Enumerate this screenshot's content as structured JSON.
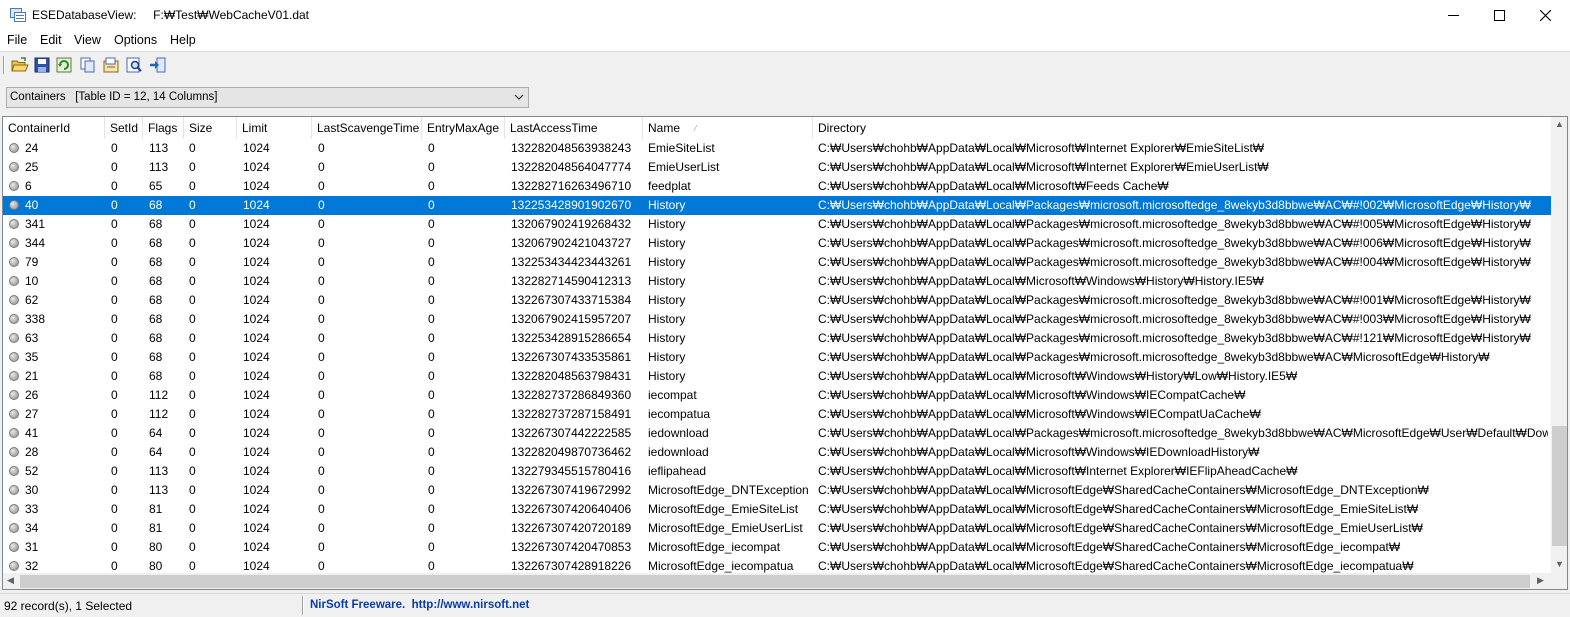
{
  "window": {
    "title": "ESEDatabaseView:     F:₩Test₩WebCacheV01.dat"
  },
  "menu": [
    {
      "label": "File"
    },
    {
      "label": "Edit"
    },
    {
      "label": "View"
    },
    {
      "label": "Options"
    },
    {
      "label": "Help"
    }
  ],
  "toolbar": {
    "icons": [
      "open-folder-icon",
      "save-icon",
      "refresh-icon",
      "copy-icon",
      "properties-icon",
      "find-icon",
      "exit-icon"
    ]
  },
  "table_select": {
    "value": "Containers   [Table ID = 12, 14 Columns]"
  },
  "table": {
    "columns": [
      "ContainerId",
      "SetId",
      "Flags",
      "Size",
      "Limit",
      "LastScavengeTime",
      "EntryMaxAge",
      "LastAccessTime",
      "Name",
      "Directory"
    ],
    "sort_column": "Name",
    "rows": [
      [
        "24",
        "0",
        "113",
        "0",
        "1024",
        "0",
        "0",
        "132282048563938243",
        "EmieSiteList",
        "C:₩Users₩chohb₩AppData₩Local₩Microsoft₩Internet Explorer₩EmieSiteList₩"
      ],
      [
        "25",
        "0",
        "113",
        "0",
        "1024",
        "0",
        "0",
        "132282048564047774",
        "EmieUserList",
        "C:₩Users₩chohb₩AppData₩Local₩Microsoft₩Internet Explorer₩EmieUserList₩"
      ],
      [
        "6",
        "0",
        "65",
        "0",
        "1024",
        "0",
        "0",
        "132282716263496710",
        "feedplat",
        "C:₩Users₩chohb₩AppData₩Local₩Microsoft₩Feeds Cache₩"
      ],
      [
        "40",
        "0",
        "68",
        "0",
        "1024",
        "0",
        "0",
        "132253428901902670",
        "History",
        "C:₩Users₩chohb₩AppData₩Local₩Packages₩microsoft.microsoftedge_8wekyb3d8bbwe₩AC₩#!002₩MicrosoftEdge₩History₩"
      ],
      [
        "341",
        "0",
        "68",
        "0",
        "1024",
        "0",
        "0",
        "132067902419268432",
        "History",
        "C:₩Users₩chohb₩AppData₩Local₩Packages₩microsoft.microsoftedge_8wekyb3d8bbwe₩AC₩#!005₩MicrosoftEdge₩History₩"
      ],
      [
        "344",
        "0",
        "68",
        "0",
        "1024",
        "0",
        "0",
        "132067902421043727",
        "History",
        "C:₩Users₩chohb₩AppData₩Local₩Packages₩microsoft.microsoftedge_8wekyb3d8bbwe₩AC₩#!006₩MicrosoftEdge₩History₩"
      ],
      [
        "79",
        "0",
        "68",
        "0",
        "1024",
        "0",
        "0",
        "132253434423443261",
        "History",
        "C:₩Users₩chohb₩AppData₩Local₩Packages₩microsoft.microsoftedge_8wekyb3d8bbwe₩AC₩#!004₩MicrosoftEdge₩History₩"
      ],
      [
        "10",
        "0",
        "68",
        "0",
        "1024",
        "0",
        "0",
        "132282714590412313",
        "History",
        "C:₩Users₩chohb₩AppData₩Local₩Microsoft₩Windows₩History₩History.IE5₩"
      ],
      [
        "62",
        "0",
        "68",
        "0",
        "1024",
        "0",
        "0",
        "132267307433715384",
        "History",
        "C:₩Users₩chohb₩AppData₩Local₩Packages₩microsoft.microsoftedge_8wekyb3d8bbwe₩AC₩#!001₩MicrosoftEdge₩History₩"
      ],
      [
        "338",
        "0",
        "68",
        "0",
        "1024",
        "0",
        "0",
        "132067902415957207",
        "History",
        "C:₩Users₩chohb₩AppData₩Local₩Packages₩microsoft.microsoftedge_8wekyb3d8bbwe₩AC₩#!003₩MicrosoftEdge₩History₩"
      ],
      [
        "63",
        "0",
        "68",
        "0",
        "1024",
        "0",
        "0",
        "132253428915286654",
        "History",
        "C:₩Users₩chohb₩AppData₩Local₩Packages₩microsoft.microsoftedge_8wekyb3d8bbwe₩AC₩#!121₩MicrosoftEdge₩History₩"
      ],
      [
        "35",
        "0",
        "68",
        "0",
        "1024",
        "0",
        "0",
        "132267307433535861",
        "History",
        "C:₩Users₩chohb₩AppData₩Local₩Packages₩microsoft.microsoftedge_8wekyb3d8bbwe₩AC₩MicrosoftEdge₩History₩"
      ],
      [
        "21",
        "0",
        "68",
        "0",
        "1024",
        "0",
        "0",
        "132282048563798431",
        "History",
        "C:₩Users₩chohb₩AppData₩Local₩Microsoft₩Windows₩History₩Low₩History.IE5₩"
      ],
      [
        "26",
        "0",
        "112",
        "0",
        "1024",
        "0",
        "0",
        "132282737286849360",
        "iecompat",
        "C:₩Users₩chohb₩AppData₩Local₩Microsoft₩Windows₩IECompatCache₩"
      ],
      [
        "27",
        "0",
        "112",
        "0",
        "1024",
        "0",
        "0",
        "132282737287158491",
        "iecompatua",
        "C:₩Users₩chohb₩AppData₩Local₩Microsoft₩Windows₩IECompatUaCache₩"
      ],
      [
        "41",
        "0",
        "64",
        "0",
        "1024",
        "0",
        "0",
        "132267307442222585",
        "iedownload",
        "C:₩Users₩chohb₩AppData₩Local₩Packages₩microsoft.microsoftedge_8wekyb3d8bbwe₩AC₩MicrosoftEdge₩User₩Default₩Download"
      ],
      [
        "28",
        "0",
        "64",
        "0",
        "1024",
        "0",
        "0",
        "132282049870736462",
        "iedownload",
        "C:₩Users₩chohb₩AppData₩Local₩Microsoft₩Windows₩IEDownloadHistory₩"
      ],
      [
        "52",
        "0",
        "113",
        "0",
        "1024",
        "0",
        "0",
        "132279345515780416",
        "ieflipahead",
        "C:₩Users₩chohb₩AppData₩Local₩Microsoft₩Internet Explorer₩IEFlipAheadCache₩"
      ],
      [
        "30",
        "0",
        "113",
        "0",
        "1024",
        "0",
        "0",
        "132267307419672992",
        "MicrosoftEdge_DNTException",
        "C:₩Users₩chohb₩AppData₩Local₩MicrosoftEdge₩SharedCacheContainers₩MicrosoftEdge_DNTException₩"
      ],
      [
        "33",
        "0",
        "81",
        "0",
        "1024",
        "0",
        "0",
        "132267307420640406",
        "MicrosoftEdge_EmieSiteList",
        "C:₩Users₩chohb₩AppData₩Local₩MicrosoftEdge₩SharedCacheContainers₩MicrosoftEdge_EmieSiteList₩"
      ],
      [
        "34",
        "0",
        "81",
        "0",
        "1024",
        "0",
        "0",
        "132267307420720189",
        "MicrosoftEdge_EmieUserList",
        "C:₩Users₩chohb₩AppData₩Local₩MicrosoftEdge₩SharedCacheContainers₩MicrosoftEdge_EmieUserList₩"
      ],
      [
        "31",
        "0",
        "80",
        "0",
        "1024",
        "0",
        "0",
        "132267307420470853",
        "MicrosoftEdge_iecompat",
        "C:₩Users₩chohb₩AppData₩Local₩MicrosoftEdge₩SharedCacheContainers₩MicrosoftEdge_iecompat₩"
      ],
      [
        "32",
        "0",
        "80",
        "0",
        "1024",
        "0",
        "0",
        "132267307428918226",
        "MicrosoftEdge_iecompatua",
        "C:₩Users₩chohb₩AppData₩Local₩MicrosoftEdge₩SharedCacheContainers₩MicrosoftEdge_iecompatua₩"
      ]
    ],
    "selected_row": 3
  },
  "status": {
    "records": "92 record(s), 1 Selected",
    "credit": "NirSoft Freeware.  http://www.nirsoft.net"
  },
  "colors": {
    "selection": "#0078d7",
    "credit_text": "#0a3ca8"
  }
}
